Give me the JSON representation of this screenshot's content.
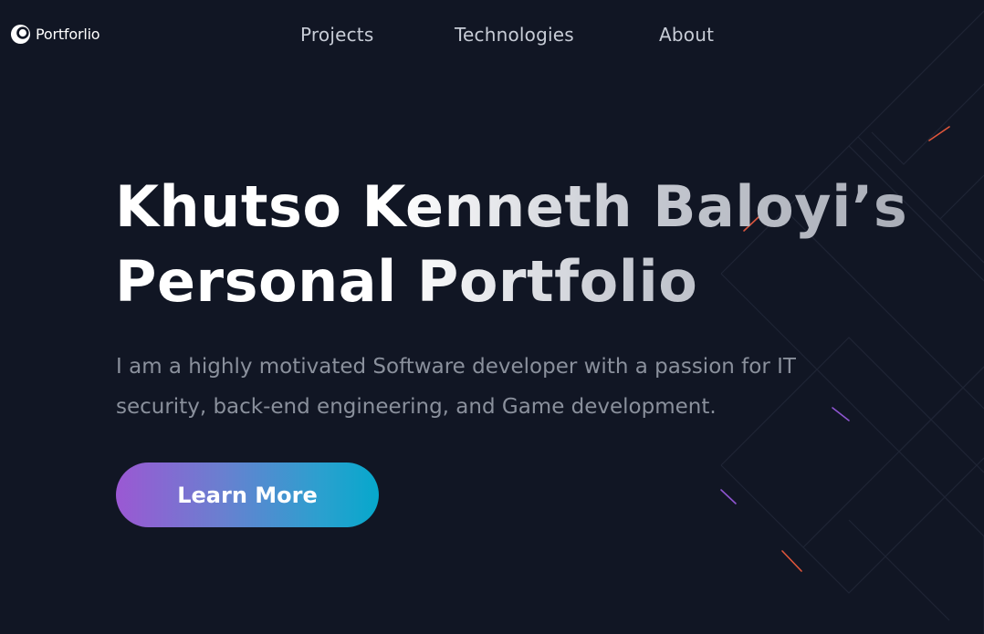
{
  "nav": {
    "logo_text": "Portforlio",
    "links": [
      {
        "label": "Projects"
      },
      {
        "label": "Technologies"
      },
      {
        "label": "About"
      }
    ]
  },
  "hero": {
    "title_line1": "Khutso Kenneth Baloyi’s",
    "title_line2": "Personal Portfolio",
    "description": "I am a highly motivated Software developer with a passion for IT security, back-end engineering, and Game development.",
    "cta_label": "Learn More"
  },
  "colors": {
    "background": "#111624",
    "nav_link": "#c7ccd6",
    "description": "#8a909c",
    "cta_gradient_start": "#9b58d3",
    "cta_gradient_end": "#06a8cc"
  }
}
